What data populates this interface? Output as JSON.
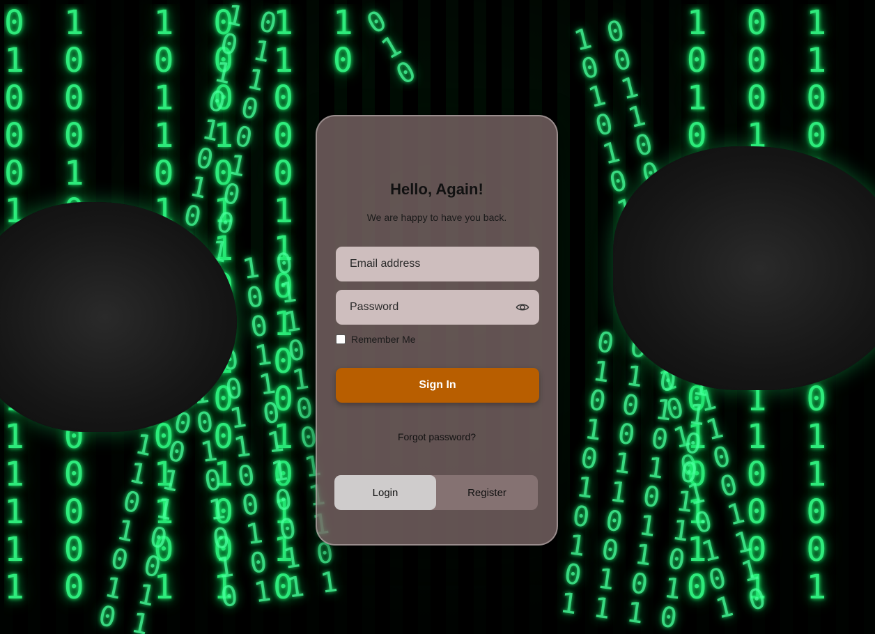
{
  "login": {
    "title": "Hello, Again!",
    "subtitle": "We are happy to have you back.",
    "email_placeholder": "Email address",
    "password_placeholder": "Password",
    "remember_label": "Remember Me",
    "signin_label": "Sign In",
    "forgot_label": "Forgot password?",
    "tabs": [
      {
        "label": "Login",
        "active": true
      },
      {
        "label": "Register",
        "active": false
      }
    ]
  },
  "colors": {
    "accent": "#b85e00",
    "card": "#786464",
    "matrix_green": "#33ff88"
  },
  "icons": {
    "password_toggle": "eye-icon"
  }
}
